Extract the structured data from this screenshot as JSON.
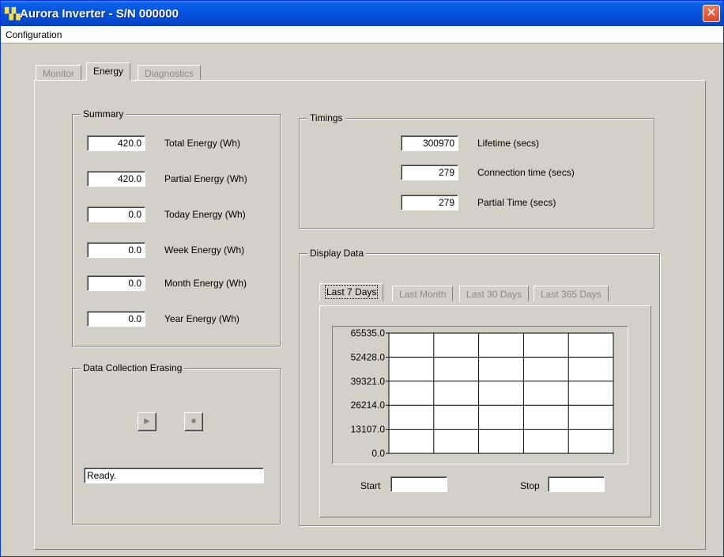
{
  "window": {
    "title": "Aurora Inverter - S/N 000000",
    "close_glyph": "✕"
  },
  "menu": {
    "items": [
      "Configuration"
    ]
  },
  "tabs": [
    {
      "label": "Monitor",
      "active": false
    },
    {
      "label": "Energy",
      "active": true
    },
    {
      "label": "Diagnostics",
      "active": false
    }
  ],
  "summary": {
    "legend": "Summary",
    "rows": [
      {
        "value": "420.0",
        "label": "Total Energy (Wh)"
      },
      {
        "value": "420.0",
        "label": "Partial Energy (Wh)"
      },
      {
        "value": "0.0",
        "label": "Today Energy (Wh)"
      },
      {
        "value": "0.0",
        "label": "Week Energy (Wh)"
      },
      {
        "value": "0.0",
        "label": "Month Energy (Wh)"
      },
      {
        "value": "0.0",
        "label": "Year Energy (Wh)"
      }
    ]
  },
  "timings": {
    "legend": "Timings",
    "rows": [
      {
        "value": "300970",
        "label": "Lifetime (secs)"
      },
      {
        "value": "279",
        "label": "Connection time (secs)"
      },
      {
        "value": "279",
        "label": "Partial Time (secs)"
      }
    ]
  },
  "erasing": {
    "legend": "Data Collection Erasing",
    "play_icon": "play-icon",
    "stop_icon": "stop-icon",
    "status": "Ready."
  },
  "display": {
    "legend": "Display Data",
    "tabs": [
      {
        "label": "Last 7 Days",
        "active": true
      },
      {
        "label": "Last Month",
        "active": false
      },
      {
        "label": "Last 30 Days",
        "active": false
      },
      {
        "label": "Last 365 Days",
        "active": false
      }
    ],
    "start_label": "Start",
    "start_value": "",
    "stop_label": "Stop",
    "stop_value": ""
  },
  "chart_data": {
    "type": "bar",
    "categories": [],
    "values": [],
    "title": "",
    "xlabel": "",
    "ylabel": "",
    "ylim": [
      0,
      65535
    ],
    "yticks": [
      "65535.0",
      "52428.0",
      "39321.0",
      "26214.0",
      "13107.0",
      "0.0"
    ],
    "x_gridlines": 5,
    "grid": true,
    "background": "#ffffff"
  }
}
